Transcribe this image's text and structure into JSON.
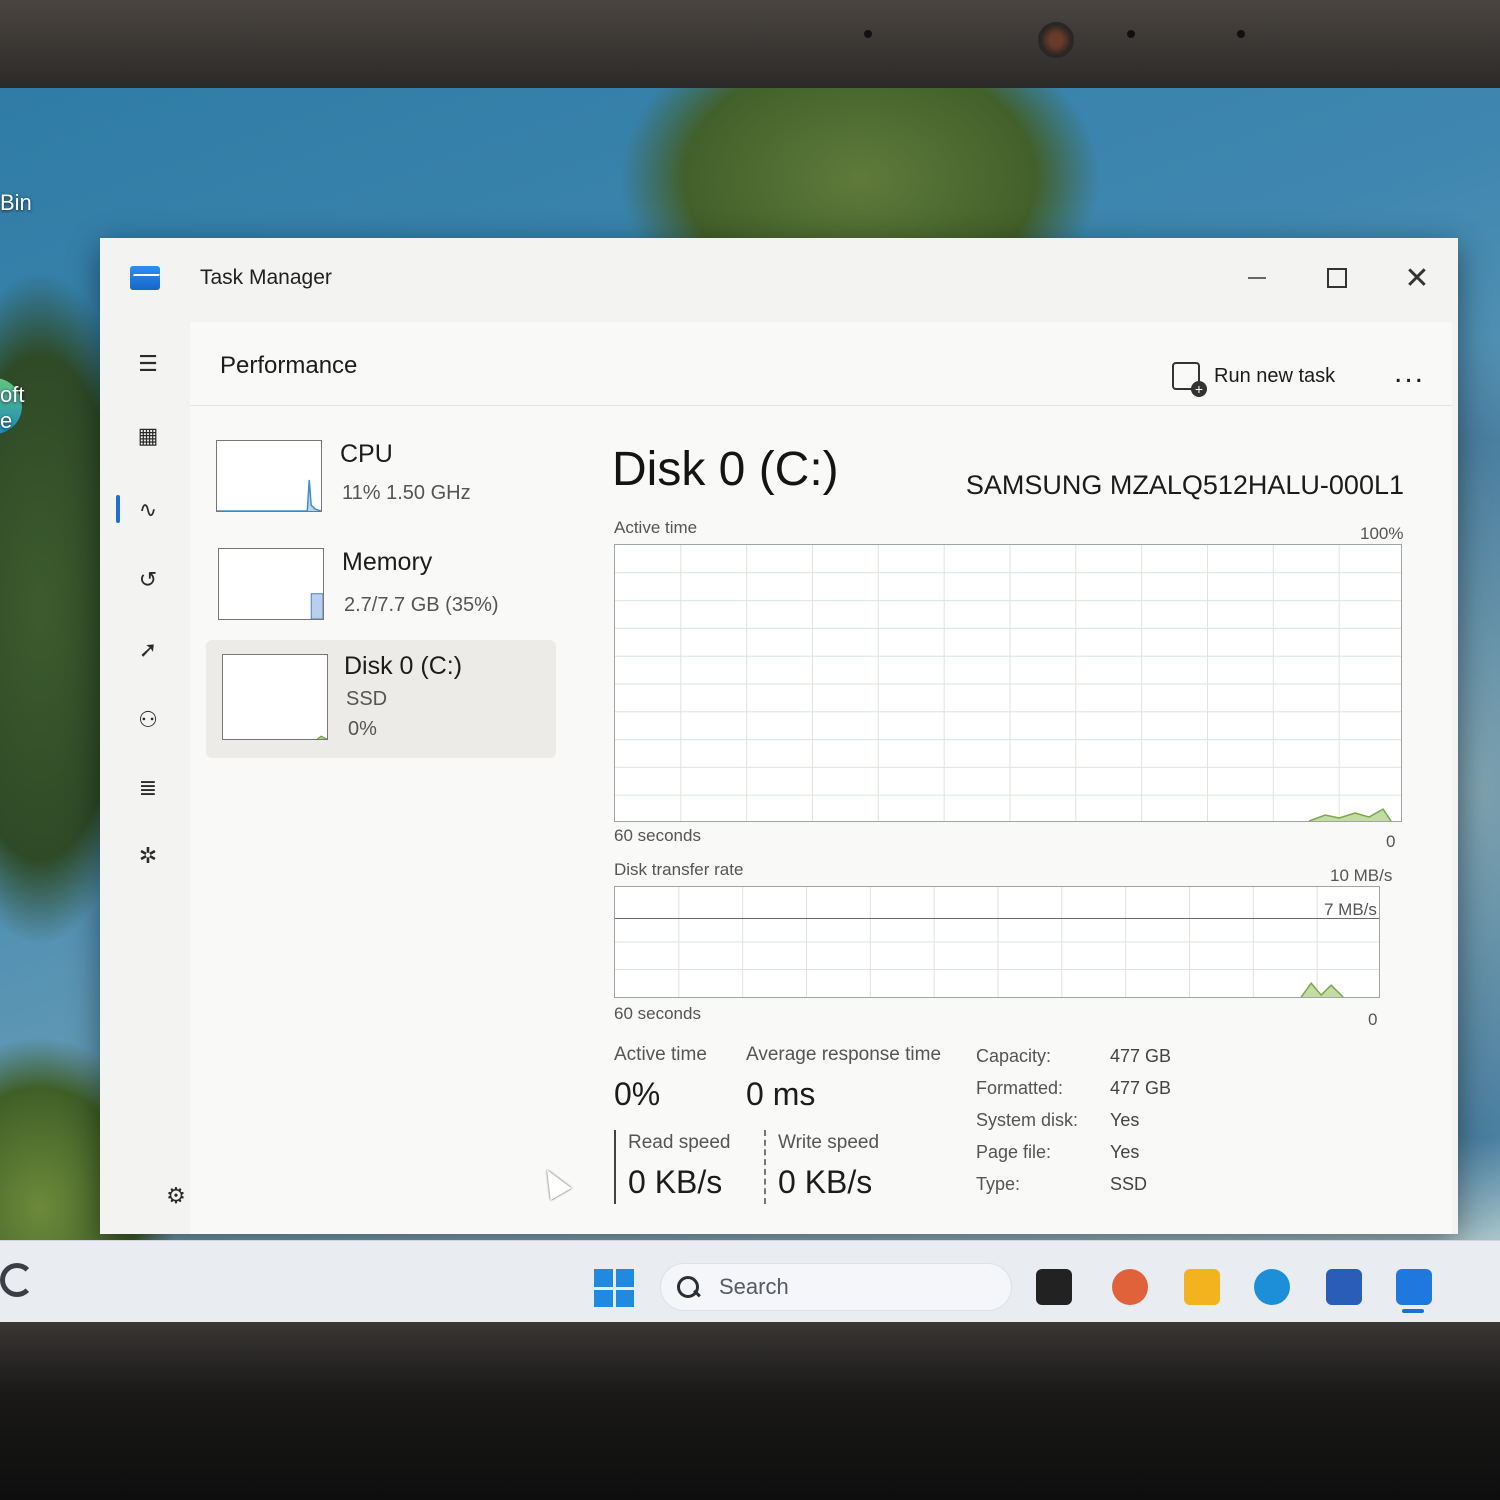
{
  "desktop": {
    "labels": [
      "Bin",
      "oft",
      "e"
    ]
  },
  "window": {
    "title": "Task Manager",
    "controls": {
      "minimize": "—",
      "maximize": "☐",
      "close": "✕"
    }
  },
  "nav": {
    "items": [
      {
        "name": "hamburger-menu-icon",
        "glyph": "☰"
      },
      {
        "name": "processes-icon",
        "glyph": "▦"
      },
      {
        "name": "performance-icon",
        "glyph": "∿"
      },
      {
        "name": "app-history-icon",
        "glyph": "↺"
      },
      {
        "name": "startup-apps-icon",
        "glyph": "➚"
      },
      {
        "name": "users-icon",
        "glyph": "⚇"
      },
      {
        "name": "details-icon",
        "glyph": "≣"
      },
      {
        "name": "services-icon",
        "glyph": "✲"
      }
    ],
    "settings_glyph": "⚙"
  },
  "header": {
    "title": "Performance",
    "run_new_task": "Run new task",
    "more": "..."
  },
  "devices": [
    {
      "name": "CPU",
      "line1": "11%  1.50 GHz",
      "line2": ""
    },
    {
      "name": "Memory",
      "line1": "2.7/7.7 GB (35%)",
      "line2": ""
    },
    {
      "name": "Disk 0 (C:)",
      "line1": "SSD",
      "line2": "0%"
    }
  ],
  "detail": {
    "title": "Disk 0 (C:)",
    "model": "SAMSUNG MZALQ512HALU-000L1",
    "active_time_graph": {
      "label": "Active time",
      "max": "100%",
      "duration": "60 seconds",
      "min": "0"
    },
    "transfer_graph": {
      "label": "Disk transfer rate",
      "max": "10 MB/s",
      "marker": "7 MB/s",
      "duration": "60 seconds",
      "min": "0"
    },
    "stats": {
      "active_time_label": "Active time",
      "active_time_value": "0%",
      "avg_response_label": "Average response time",
      "avg_response_value": "0 ms",
      "read_label": "Read speed",
      "read_value": "0 KB/s",
      "write_label": "Write speed",
      "write_value": "0 KB/s"
    },
    "properties": [
      {
        "key": "Capacity:",
        "value": "477 GB"
      },
      {
        "key": "Formatted:",
        "value": "477 GB"
      },
      {
        "key": "System disk:",
        "value": "Yes"
      },
      {
        "key": "Page file:",
        "value": "Yes"
      },
      {
        "key": "Type:",
        "value": "SSD"
      }
    ]
  },
  "taskbar": {
    "search_placeholder": "Search",
    "apps": [
      {
        "name": "task-view-icon",
        "color": "#222222"
      },
      {
        "name": "copilot-icon",
        "color": "#e0623a"
      },
      {
        "name": "file-explorer-icon",
        "color": "#f2b31f"
      },
      {
        "name": "edge-icon",
        "color": "#1d8fd8"
      },
      {
        "name": "microsoft-store-icon",
        "color": "#2a5db8"
      },
      {
        "name": "task-manager-icon",
        "color": "#1f78dd"
      }
    ]
  },
  "colors": {
    "accent": "#1f6fd1",
    "graph_fill": "#9cc078",
    "graph_grid": "#d9e4dc"
  }
}
